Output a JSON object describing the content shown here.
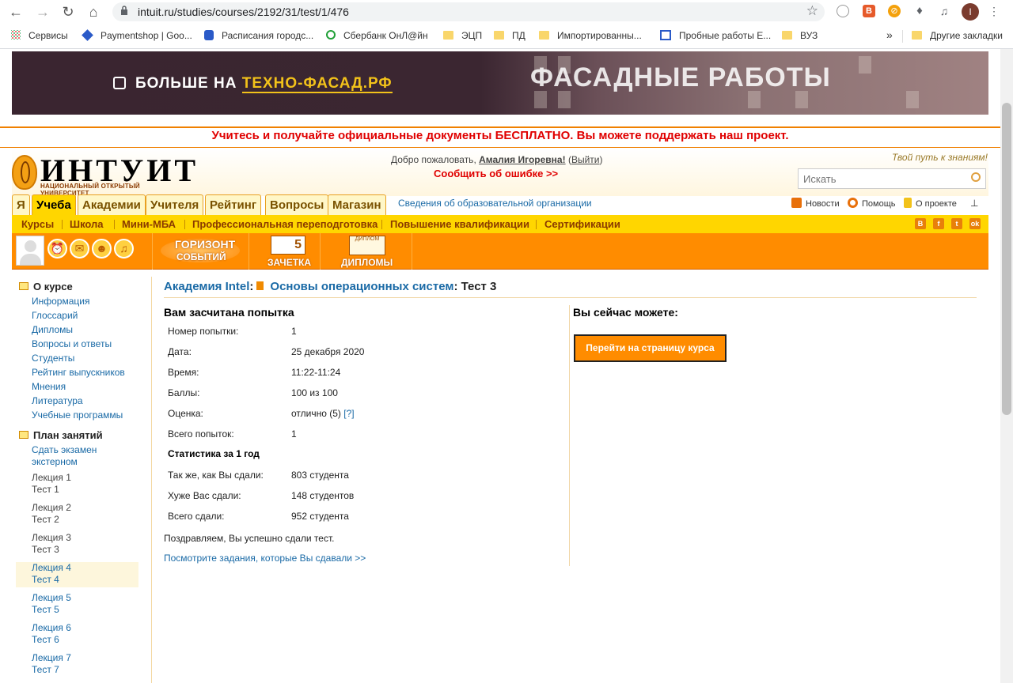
{
  "browser": {
    "url": "intuit.ru/studies/courses/2192/31/test/1/476",
    "bookmarks": [
      {
        "label": "Сервисы"
      },
      {
        "label": "Paymentshop | Goo..."
      },
      {
        "label": "Расписания городс..."
      },
      {
        "label": "Сбербанк ОнЛ@йн"
      },
      {
        "label": "ЭЦП"
      },
      {
        "label": "ПД"
      },
      {
        "label": "Импортированны..."
      },
      {
        "label": "Пробные работы Е..."
      },
      {
        "label": "ВУЗ"
      }
    ],
    "bookmarks_more": "»",
    "other_bookmarks": "Другие закладки",
    "profile_initial": "I"
  },
  "banner": {
    "text": "БОЛЬШЕ НА ",
    "site": "ТЕХНО-ФАСАД.РФ",
    "image_text": "ФАСАДНЫЕ РАБОТЫ"
  },
  "promo": "Учитесь и получайте официальные документы БЕСПЛАТНО. Вы можете поддержать наш проект.",
  "header": {
    "logo_name": "ИНТУИТ",
    "logo_sub": "НАЦИОНАЛЬНЫЙ ОТКРЫТЫЙ УНИВЕРСИТЕТ",
    "welcome": "Добро пожаловать, ",
    "user": "Амалия Игоревна!",
    "logout_open": " (",
    "logout": "Выйти",
    "logout_close": ")",
    "report_error": "Сообщить об ошибке >>",
    "slogan": "Твой путь к знаниям!",
    "search_placeholder": "Искать"
  },
  "tabs": [
    {
      "label": "Я"
    },
    {
      "label": "Учеба"
    },
    {
      "label": "Академии"
    },
    {
      "label": "Учителя"
    },
    {
      "label": "Рейтинг"
    },
    {
      "label": "Вопросы"
    },
    {
      "label": "Магазин"
    }
  ],
  "tabs_link": "Сведения об образовательной организации",
  "top_links": {
    "news": "Новости",
    "help": "Помощь",
    "about": "О проекте"
  },
  "subnav": [
    {
      "label": "Курсы"
    },
    {
      "label": "Школа"
    },
    {
      "label": "Мини-МБА"
    },
    {
      "label": "Профессиональная переподготовка"
    },
    {
      "label": "Повышение квалификации"
    },
    {
      "label": "Сертификации"
    }
  ],
  "social": [
    "В",
    "f",
    "t",
    "ok"
  ],
  "orange_bar": {
    "horizon_1": "ГОРИЗОНТ",
    "horizon_2": "СОБЫТИЙ",
    "zachetka": "ЗАЧЕТКА",
    "zachetka_grade": "5",
    "diplomas": "ДИПЛОМЫ",
    "diploma_tag": "ДИПЛОМ"
  },
  "sidebar": {
    "about_title": "О курсе",
    "about_links": [
      "Информация",
      "Глоссарий",
      "Дипломы",
      "Вопросы и ответы",
      "Студенты",
      "Рейтинг выпускников",
      "Мнения",
      "Литература",
      "Учебные программы"
    ],
    "plan_title": "План занятий",
    "exam_line1": "Сдать экзамен",
    "exam_line2": "экстерном",
    "lessons": [
      {
        "lecture": "Лекция 1",
        "test": "Тест 1"
      },
      {
        "lecture": "Лекция 2",
        "test": "Тест 2"
      },
      {
        "lecture": "Лекция 3",
        "test": "Тест 3"
      },
      {
        "lecture": "Лекция 4",
        "test": "Тест 4"
      },
      {
        "lecture": "Лекция 5",
        "test": "Тест 5"
      },
      {
        "lecture": "Лекция 6",
        "test": "Тест 6"
      },
      {
        "lecture": "Лекция 7",
        "test": "Тест 7"
      }
    ]
  },
  "breadcrumb": {
    "academy": "Академия Intel",
    "colon1": ":",
    "course": "Основы операционных систем",
    "colon2": ":",
    "current": " Тест 3"
  },
  "result": {
    "title": "Вам засчитана попытка",
    "rows": [
      {
        "label": "Номер попытки:",
        "value": "1"
      },
      {
        "label": "Дата:",
        "value": "25 декабря 2020"
      },
      {
        "label": "Время:",
        "value": "11:22-11:24"
      },
      {
        "label": "Баллы:",
        "value": "100 из 100"
      },
      {
        "label": "Оценка:",
        "value": "отлично (5)",
        "help": "[?]"
      },
      {
        "label": "Всего попыток:",
        "value": "1"
      }
    ],
    "stat_title": "Статистика за 1 год",
    "stats": [
      {
        "label": "Так же, как Вы сдали:",
        "value": "803 студента"
      },
      {
        "label": "Хуже Вас сдали:",
        "value": "148 студентов"
      },
      {
        "label": "Всего сдали:",
        "value": "952 студента"
      }
    ],
    "congrats": "Поздравляем, Вы успешно сдали тест.",
    "tasks_link": "Посмотрите задания, которые Вы сдавали >>"
  },
  "actions": {
    "title": "Вы сейчас можете:",
    "goto_course": "Перейти на страницу курса"
  }
}
